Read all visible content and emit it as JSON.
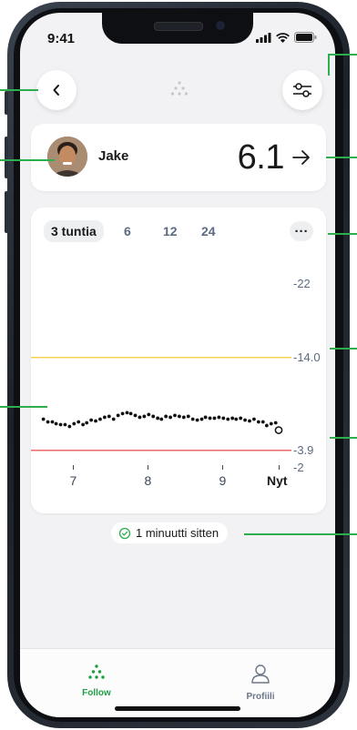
{
  "status_bar": {
    "time": "9:41"
  },
  "nav": {
    "back_icon": "chevron-left-icon",
    "center_icon": "dots-logo-icon",
    "filter_icon": "sliders-icon"
  },
  "user": {
    "name": "Jake",
    "reading": "6.1",
    "trend_icon": "arrow-right-icon"
  },
  "chart_card": {
    "tabs": [
      {
        "label": "3 tuntia",
        "active": true
      },
      {
        "label": "6",
        "active": false
      },
      {
        "label": "12",
        "active": false
      },
      {
        "label": "24",
        "active": false
      }
    ],
    "more_label": "···"
  },
  "chart_data": {
    "type": "scatter",
    "x_tick_labels": [
      "7",
      "8",
      "9",
      "Nyt"
    ],
    "x_tick_values": [
      7,
      8,
      9,
      9.75
    ],
    "y_tick_labels": [
      "22",
      "14.0",
      "3.9",
      "2"
    ],
    "y_tick_values": [
      22,
      14.0,
      3.9,
      2
    ],
    "ylim": [
      2,
      22
    ],
    "xlim": [
      6.58,
      9.75
    ],
    "high_threshold": 14.0,
    "low_threshold": 3.9,
    "high_color": "#f0c419",
    "low_color": "#e53935",
    "points": [
      [
        6.6,
        7.3
      ],
      [
        6.66,
        7.0
      ],
      [
        6.72,
        7.0
      ],
      [
        6.77,
        6.8
      ],
      [
        6.83,
        6.7
      ],
      [
        6.89,
        6.7
      ],
      [
        6.95,
        6.5
      ],
      [
        7.01,
        6.8
      ],
      [
        7.07,
        7.0
      ],
      [
        7.13,
        6.7
      ],
      [
        7.18,
        6.9
      ],
      [
        7.24,
        7.2
      ],
      [
        7.3,
        7.1
      ],
      [
        7.36,
        7.3
      ],
      [
        7.42,
        7.5
      ],
      [
        7.48,
        7.6
      ],
      [
        7.54,
        7.3
      ],
      [
        7.6,
        7.7
      ],
      [
        7.66,
        7.9
      ],
      [
        7.72,
        8.0
      ],
      [
        7.77,
        7.9
      ],
      [
        7.83,
        7.7
      ],
      [
        7.89,
        7.5
      ],
      [
        7.95,
        7.6
      ],
      [
        8.01,
        7.8
      ],
      [
        8.07,
        7.6
      ],
      [
        8.13,
        7.4
      ],
      [
        8.18,
        7.3
      ],
      [
        8.24,
        7.6
      ],
      [
        8.3,
        7.5
      ],
      [
        8.36,
        7.7
      ],
      [
        8.42,
        7.6
      ],
      [
        8.48,
        7.5
      ],
      [
        8.54,
        7.6
      ],
      [
        8.6,
        7.3
      ],
      [
        8.66,
        7.2
      ],
      [
        8.72,
        7.3
      ],
      [
        8.77,
        7.5
      ],
      [
        8.83,
        7.4
      ],
      [
        8.89,
        7.4
      ],
      [
        8.95,
        7.5
      ],
      [
        9.01,
        7.4
      ],
      [
        9.07,
        7.3
      ],
      [
        9.13,
        7.4
      ],
      [
        9.18,
        7.3
      ],
      [
        9.24,
        7.4
      ],
      [
        9.3,
        7.2
      ],
      [
        9.36,
        7.1
      ],
      [
        9.42,
        7.3
      ],
      [
        9.48,
        7.0
      ],
      [
        9.54,
        7.0
      ],
      [
        9.59,
        6.6
      ],
      [
        9.65,
        6.8
      ],
      [
        9.71,
        6.9
      ]
    ],
    "latest_point": [
      9.75,
      6.1
    ],
    "point_color": "#111111",
    "grid": false
  },
  "last_update": {
    "label": "1 minuutti sitten",
    "icon": "check-circle-icon"
  },
  "tabbar": {
    "items": [
      {
        "label": "Follow",
        "icon": "follow-dots-icon",
        "color": "#1f9d45"
      },
      {
        "label": "Profiili",
        "icon": "profile-person-icon",
        "color": "#6b7686"
      }
    ]
  },
  "colors": {
    "accent": "#2fae4e",
    "follow_green": "#1f9d45"
  }
}
